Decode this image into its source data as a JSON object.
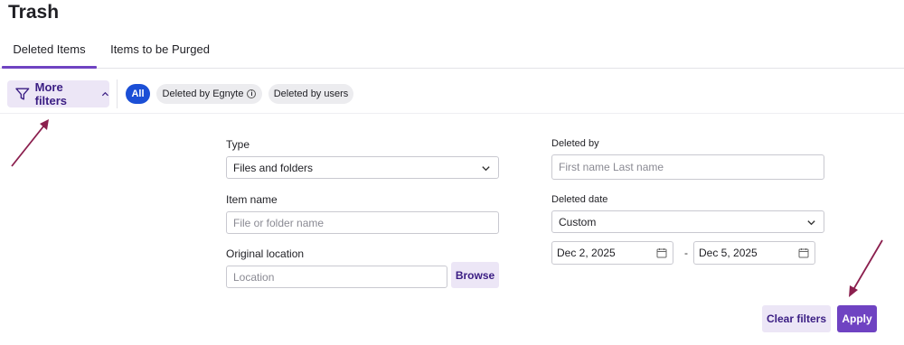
{
  "page": {
    "title": "Trash"
  },
  "tabs": [
    {
      "label": "Deleted Items",
      "active": true
    },
    {
      "label": "Items to be Purged",
      "active": false
    }
  ],
  "filter_bar": {
    "more_filters_label": "More filters",
    "chips": [
      {
        "label": "All",
        "selected": true
      },
      {
        "label": "Deleted by Egnyte",
        "selected": false,
        "icon": "info-icon"
      },
      {
        "label": "Deleted by users",
        "selected": false
      }
    ]
  },
  "form": {
    "type": {
      "label": "Type",
      "value": "Files and folders"
    },
    "item_name": {
      "label": "Item name",
      "placeholder": "File or folder name"
    },
    "original_location": {
      "label": "Original location",
      "placeholder": "Location",
      "browse_label": "Browse"
    },
    "deleted_by": {
      "label": "Deleted by",
      "placeholder": "First name Last name"
    },
    "deleted_date": {
      "label": "Deleted date",
      "value": "Custom",
      "from": "Dec 2, 2025",
      "separator": "-",
      "to": "Dec 5, 2025"
    }
  },
  "actions": {
    "clear_label": "Clear filters",
    "apply_label": "Apply"
  },
  "colors": {
    "accent": "#6f43c2",
    "chip_selected": "#1b4fd6",
    "annotation_arrow": "#8b1f4e"
  }
}
